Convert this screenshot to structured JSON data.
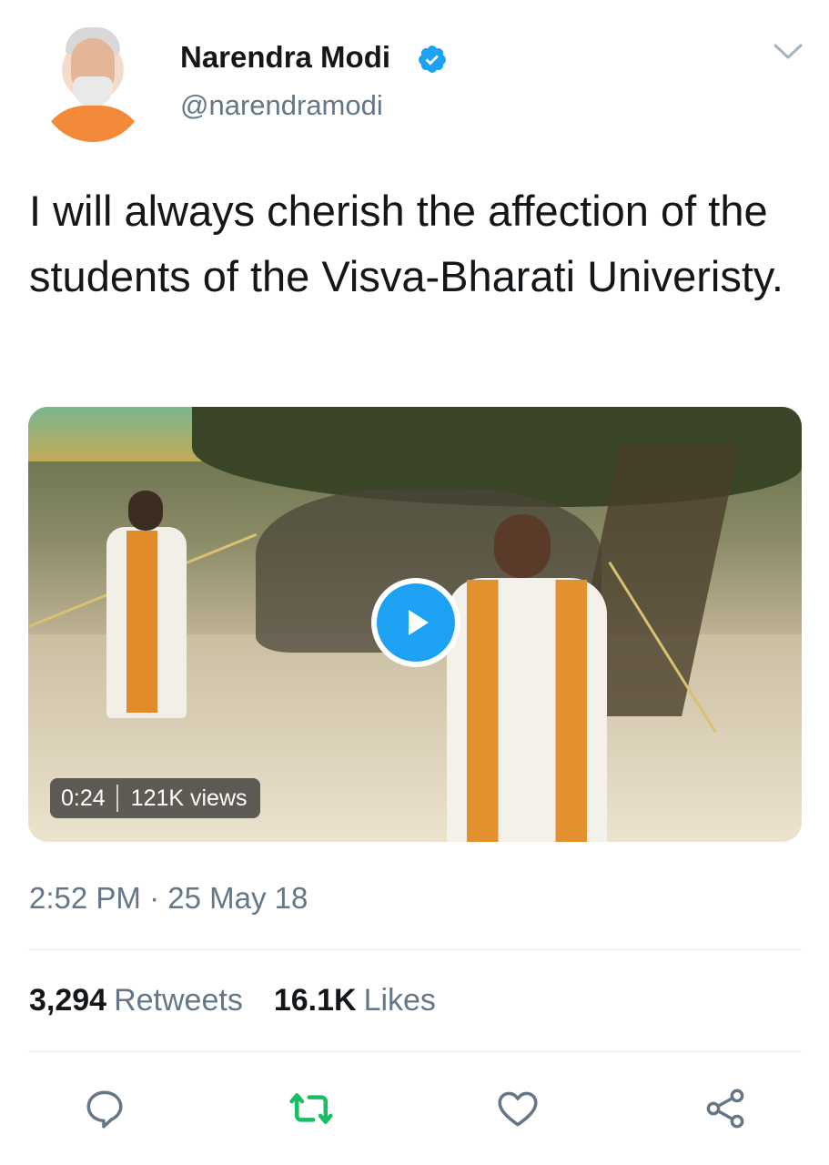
{
  "author": {
    "name": "Narendra Modi",
    "handle": "@narendramodi",
    "verified": true
  },
  "tweet": {
    "text": "I will always cherish the affection of the students of the Visva-Bharati Univeristy."
  },
  "video": {
    "duration": "0:24",
    "views": "121K views"
  },
  "timestamp": "2:52 PM · 25 May 18",
  "stats": {
    "retweets_count": "3,294",
    "retweets_label": "Retweets",
    "likes_count": "16.1K",
    "likes_label": "Likes"
  },
  "actions": {
    "reply_icon": "reply-icon",
    "retweet_icon": "retweet-icon",
    "like_icon": "heart-icon",
    "share_icon": "share-icon"
  },
  "colors": {
    "accent": "#1da1f2",
    "retweet": "#17bf63",
    "secondary_text": "#657786",
    "icon_gray": "#657786"
  }
}
